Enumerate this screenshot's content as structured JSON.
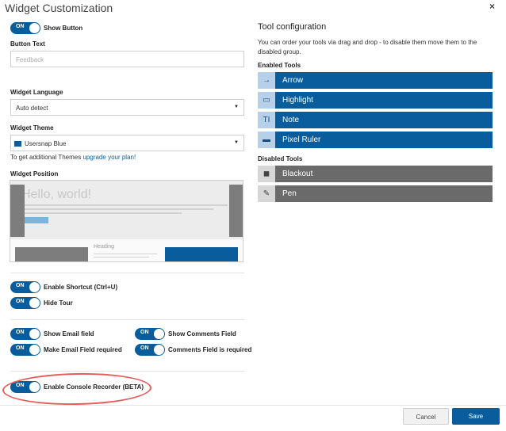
{
  "dialog": {
    "title": "Widget Customization",
    "close_glyph": "×"
  },
  "toggles": {
    "on_text": "ON",
    "show_button": "Show Button",
    "enable_shortcut": "Enable Shortcut (Ctrl+U)",
    "hide_tour": "Hide Tour",
    "show_email": "Show Email field",
    "email_required": "Make Email Field required",
    "show_comments": "Show Comments Field",
    "comments_required": "Comments Field is required",
    "console_recorder": "Enable Console Recorder (BETA)"
  },
  "button_text": {
    "label": "Button Text",
    "placeholder": "Feedback"
  },
  "language": {
    "label": "Widget Language",
    "value": "Auto detect"
  },
  "theme": {
    "label": "Widget Theme",
    "value": "Usersnap Blue",
    "swatch_color": "#0a5d9c",
    "hint_prefix": "To get additional Themes",
    "hint_link": "upgrade your plan!"
  },
  "position": {
    "label": "Widget Position",
    "preview_heading": "Hello, world!",
    "preview_subheading": "Heading"
  },
  "tool_config": {
    "title": "Tool configuration",
    "description": "You can order your tools via drag and drop - to disable them move them to the disabled group.",
    "enabled_label": "Enabled Tools",
    "enabled": [
      {
        "name": "Arrow",
        "icon": "arrow-icon",
        "glyph": "→"
      },
      {
        "name": "Highlight",
        "icon": "highlight-icon",
        "glyph": "▭"
      },
      {
        "name": "Note",
        "icon": "note-icon",
        "glyph": "TI"
      },
      {
        "name": "Pixel Ruler",
        "icon": "ruler-icon",
        "glyph": "▬"
      }
    ],
    "disabled_label": "Disabled Tools",
    "disabled": [
      {
        "name": "Blackout",
        "icon": "blackout-icon",
        "glyph": "◼"
      },
      {
        "name": "Pen",
        "icon": "pen-icon",
        "glyph": "✎"
      }
    ]
  },
  "footer": {
    "cancel": "Cancel",
    "save": "Save"
  },
  "colors": {
    "accent": "#0a5d9c",
    "disabled_tool": "#6a6a6a",
    "annotation": "#e95a5a"
  }
}
